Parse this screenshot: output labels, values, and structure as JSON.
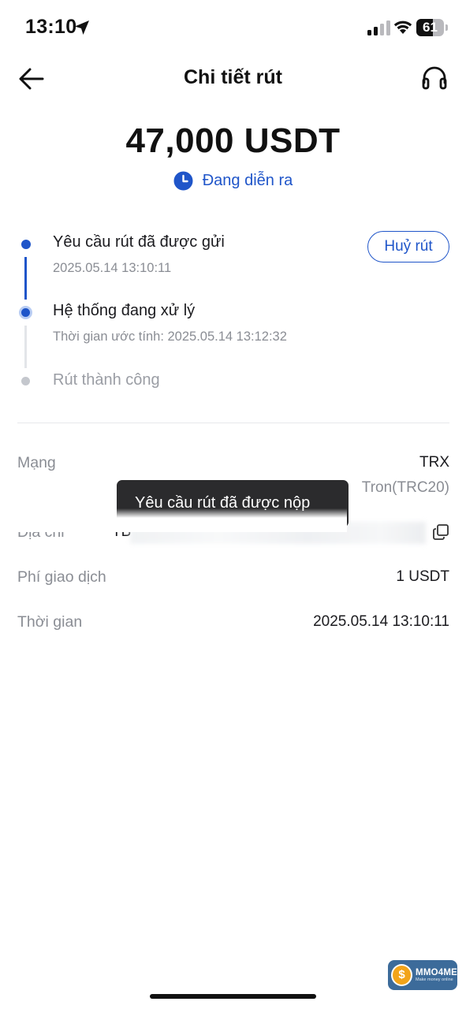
{
  "status_bar": {
    "time": "13:10",
    "battery": "61",
    "battery_level": 0.61,
    "icons": [
      "location-arrow-icon",
      "signal-icon",
      "wifi-icon",
      "battery-icon"
    ]
  },
  "header": {
    "title": "Chi tiết rút",
    "back_icon": "arrow-left-icon",
    "support_icon": "headset-icon"
  },
  "summary": {
    "amount": "47,000 USDT",
    "status": "Đang diễn ra",
    "status_icon": "clock-icon"
  },
  "timeline": [
    {
      "title": "Yêu cầu rút đã được gửi",
      "subtitle": "2025.05.14 13:10:11",
      "state": "done"
    },
    {
      "title": "Hệ thống đang xử lý",
      "subtitle": "Thời gian ước tính: 2025.05.14 13:12:32",
      "state": "current"
    },
    {
      "title": "Rút thành công",
      "subtitle": "",
      "state": "pending"
    }
  ],
  "actions": {
    "cancel_label": "Huỷ rút"
  },
  "details": {
    "network": {
      "label": "Mạng",
      "value": "TRX",
      "sub_value": "Tron(TRC20)"
    },
    "address": {
      "label": "Địa chỉ",
      "value_visible": "TB",
      "copy_icon": "copy-icon"
    },
    "fee": {
      "label": "Phí giao dịch",
      "value": "1 USDT"
    },
    "time": {
      "label": "Thời gian",
      "value": "2025.05.14 13:10:11"
    }
  },
  "toast": {
    "text": "Yêu cầu rút đã được nộp"
  },
  "watermark": {
    "name": "MMO4ME",
    "tagline": "Make money online"
  },
  "colors": {
    "accent": "#1f55c9",
    "toast_bg": "#2b2b2d",
    "muted_text": "#8a8d94",
    "timeline_pending": "#c4c7cd"
  }
}
